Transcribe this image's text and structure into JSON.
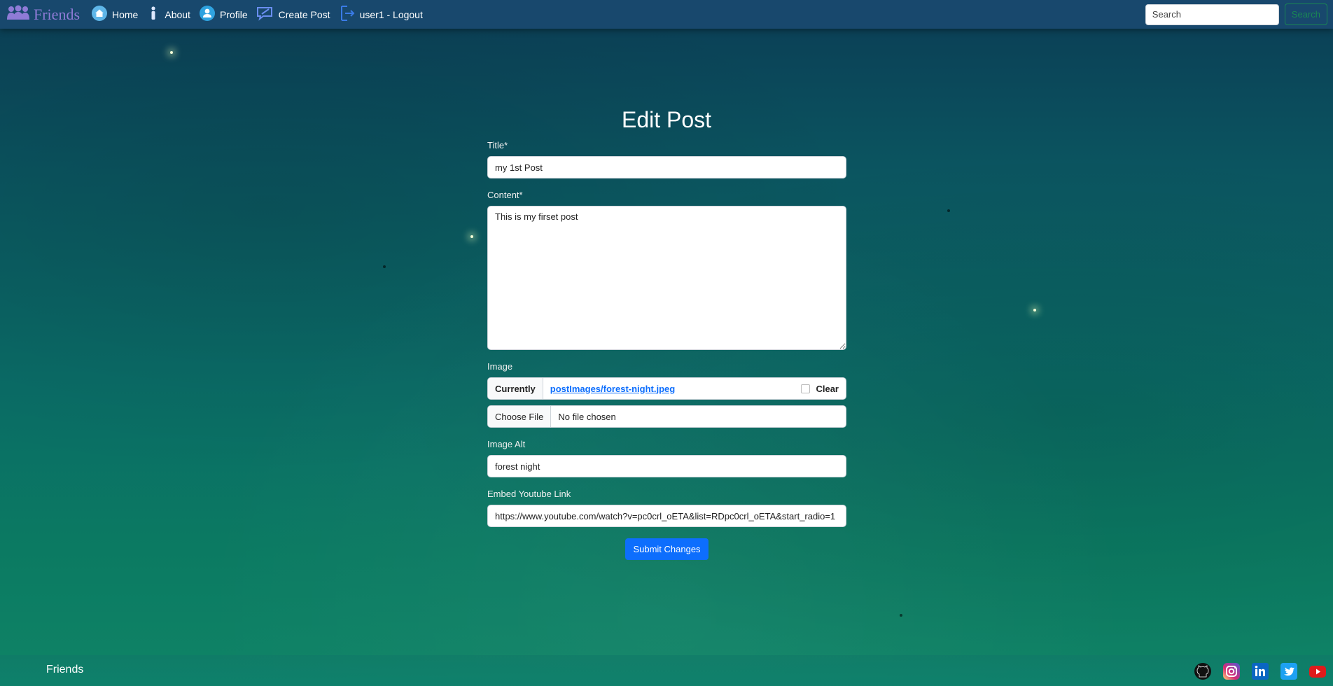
{
  "nav": {
    "brand": "Friends",
    "items": [
      {
        "label": "Home",
        "icon": "home-icon"
      },
      {
        "label": "About",
        "icon": "info-icon"
      },
      {
        "label": "Profile",
        "icon": "profile-icon"
      },
      {
        "label": "Create Post",
        "icon": "create-post-icon"
      },
      {
        "label": "user1 - Logout",
        "icon": "logout-icon"
      }
    ],
    "search_placeholder": "Search",
    "search_button": "Search"
  },
  "form": {
    "heading": "Edit Post",
    "title_label": "Title*",
    "title_value": "my 1st Post",
    "content_label": "Content*",
    "content_value": "This is my firset post",
    "image_label": "Image",
    "image_currently": "Currently",
    "image_current_file": "postImages/forest-night.jpeg",
    "image_clear_label": "Clear",
    "choose_file_label": "Choose File",
    "no_file_text": "No file chosen",
    "image_alt_label": "Image Alt",
    "image_alt_value": "forest night",
    "youtube_label": "Embed Youtube Link",
    "youtube_value": "https://www.youtube.com/watch?v=pc0crl_oETA&list=RDpc0crl_oETA&start_radio=1",
    "submit_label": "Submit Changes"
  },
  "footer": {
    "brand": "Friends",
    "social": [
      "github-icon",
      "instagram-icon",
      "linkedin-icon",
      "twitter-icon",
      "youtube-icon"
    ]
  },
  "colors": {
    "navbar": "#18486d",
    "brand": "#8f7bd6",
    "primary_button": "#0d6efd",
    "search_button": "#198754",
    "link": "#0d6efd"
  }
}
